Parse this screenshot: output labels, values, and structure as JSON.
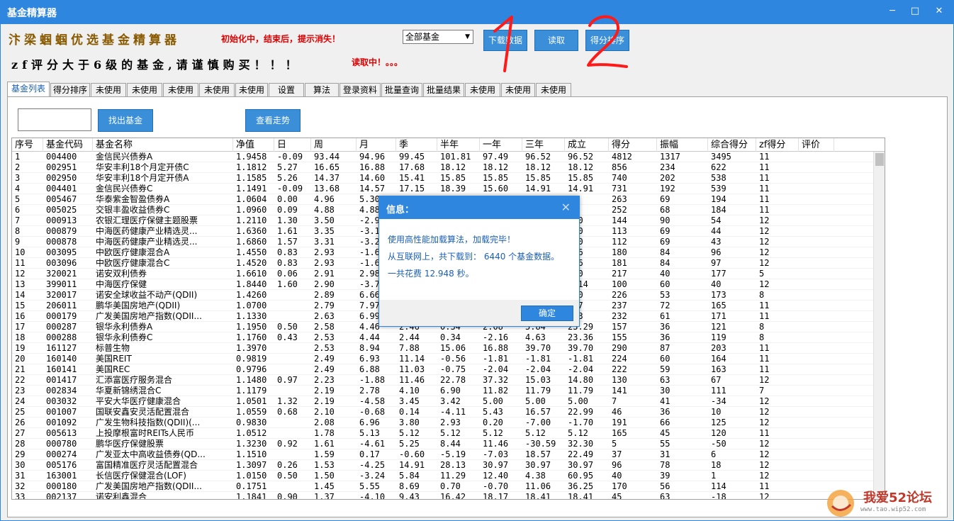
{
  "window": {
    "title": "基金精算器",
    "minimize": "─",
    "maximize": "□",
    "close": "✕"
  },
  "header": {
    "brand": "汴梁蝈蝈优选基金精算器",
    "init_message": "初始化中，结束后，提示消失！",
    "warning": "zf评分大于6级的基金,请谨慎购买！！！",
    "reading_status": "读取中！。。。",
    "filter_select": "全部基金",
    "download_button": "下载数据",
    "read_button": "读取",
    "sort_button": "得分排序",
    "annotation_1": "1",
    "annotation_2": "2"
  },
  "tabs": [
    "基金列表",
    "得分排序",
    "未使用",
    "未使用",
    "未使用",
    "未使用",
    "未使用",
    "设置",
    "算法",
    "登录资料",
    "批量查询",
    "批量结果",
    "未使用",
    "未使用",
    "未使用"
  ],
  "toolbar": {
    "find_button": "找出基金",
    "trend_button": "查看走势"
  },
  "grid": {
    "columns": [
      "序号",
      "基金代码",
      "基金名称",
      "净值",
      "日",
      "周",
      "月",
      "季",
      "半年",
      "一年",
      "三年",
      "成立",
      "得分",
      "振幅",
      "综合得分",
      "zf得分",
      "评价"
    ],
    "rows": [
      [
        "1",
        "004400",
        "金信民兴债券A",
        "1.9458",
        "-0.09",
        "93.44",
        "94.96",
        "99.45",
        "101.81",
        "97.49",
        "96.52",
        "96.52",
        "4812",
        "1317",
        "3495",
        "11",
        ""
      ],
      [
        "2",
        "002951",
        "华安丰利18个月定开债C",
        "1.1812",
        "5.27",
        "16.65",
        "16.88",
        "17.68",
        "18.12",
        "18.12",
        "18.12",
        "18.12",
        "856",
        "234",
        "622",
        "11",
        ""
      ],
      [
        "3",
        "002950",
        "华安丰利18个月定开债A",
        "1.1585",
        "5.26",
        "14.37",
        "14.60",
        "15.41",
        "15.85",
        "15.85",
        "15.85",
        "15.85",
        "740",
        "202",
        "538",
        "11",
        ""
      ],
      [
        "4",
        "004401",
        "金信民兴债券C",
        "1.1491",
        "-0.09",
        "13.68",
        "14.57",
        "17.15",
        "18.39",
        "15.60",
        "14.91",
        "14.91",
        "731",
        "192",
        "539",
        "11",
        ""
      ],
      [
        "5",
        "005467",
        "华泰紫金智盈债券A",
        "1.0604",
        "0.00",
        "4.96",
        "5.30",
        "",
        "",
        "",
        "",
        "04",
        "263",
        "69",
        "194",
        "11",
        ""
      ],
      [
        "6",
        "005025",
        "交银丰盈收益债券C",
        "1.0960",
        "0.09",
        "4.88",
        "4.88",
        "",
        "",
        "",
        "",
        "93",
        "252",
        "68",
        "184",
        "11",
        ""
      ],
      [
        "7",
        "000913",
        "农银汇理医疗保健主题股票",
        "1.2110",
        "1.30",
        "3.50",
        "-2.95",
        "",
        "",
        "",
        "",
        ".10",
        "144",
        "90",
        "54",
        "12",
        ""
      ],
      [
        "8",
        "000879",
        "中海医药健康产业精选灵...",
        "1.6360",
        "1.61",
        "3.35",
        "-3.14",
        "",
        "",
        "",
        "",
        ".60",
        "113",
        "69",
        "44",
        "12",
        ""
      ],
      [
        "9",
        "000878",
        "中海医药健康产业精选灵...",
        "1.6860",
        "1.57",
        "3.31",
        "-3.21",
        "",
        "",
        "",
        "",
        ".60",
        "112",
        "69",
        "43",
        "12",
        ""
      ],
      [
        "10",
        "003095",
        "中欧医疗健康混合A",
        "1.4550",
        "0.83",
        "2.93",
        "-1.69",
        "",
        "",
        "",
        "",
        ".36",
        "180",
        "84",
        "96",
        "12",
        ""
      ],
      [
        "11",
        "003096",
        "中欧医疗健康混合C",
        "1.4520",
        "0.83",
        "2.93",
        "-1.69",
        "",
        "",
        "",
        "",
        ".06",
        "181",
        "84",
        "97",
        "12",
        ""
      ],
      [
        "12",
        "320021",
        "诺安双利债券",
        "1.6610",
        "0.06",
        "2.91",
        "2.98",
        "",
        "",
        "",
        "",
        ".10",
        "217",
        "40",
        "177",
        "5",
        ""
      ],
      [
        "13",
        "399011",
        "中海医疗保健",
        "1.8440",
        "1.60",
        "2.90",
        "-3.76",
        "",
        "",
        "",
        "",
        "9.14",
        "100",
        "60",
        "40",
        "12",
        ""
      ],
      [
        "14",
        "320017",
        "诺安全球收益不动产(QDII)",
        "1.4260",
        "",
        "2.89",
        "6.66",
        "",
        "",
        "",
        "",
        ".60",
        "226",
        "53",
        "173",
        "8",
        ""
      ],
      [
        "15",
        "206011",
        "鹏华美国房地产(QDII)",
        "1.0700",
        "",
        "2.79",
        "7.97",
        "",
        "",
        "",
        "",
        ".57",
        "237",
        "72",
        "165",
        "11",
        ""
      ],
      [
        "16",
        "000179",
        "广发美国房地产指数(QDII...",
        "1.1330",
        "",
        "2.63",
        "6.99",
        "",
        "",
        "",
        "",
        ".63",
        "232",
        "61",
        "171",
        "11",
        ""
      ],
      [
        "17",
        "000287",
        "银华永利债券A",
        "1.1950",
        "0.50",
        "2.58",
        "4.46",
        "2.46",
        "0.34",
        "2.08",
        "5.84",
        "23.29",
        "157",
        "36",
        "121",
        "8",
        ""
      ],
      [
        "18",
        "000288",
        "银华永利债券C",
        "1.1760",
        "0.43",
        "2.53",
        "4.44",
        "2.44",
        "0.34",
        "-2.16",
        "4.63",
        "23.36",
        "155",
        "36",
        "119",
        "8",
        ""
      ],
      [
        "19",
        "161127",
        "标普生物",
        "1.3970",
        "",
        "2.53",
        "8.94",
        "7.88",
        "15.06",
        "16.88",
        "39.70",
        "39.70",
        "290",
        "87",
        "203",
        "11",
        ""
      ],
      [
        "20",
        "160140",
        "美国REIT",
        "0.9819",
        "",
        "2.49",
        "6.93",
        "11.14",
        "-0.56",
        "-1.81",
        "-1.81",
        "-1.81",
        "224",
        "60",
        "164",
        "11",
        ""
      ],
      [
        "21",
        "160141",
        "美国REC",
        "0.9796",
        "",
        "2.49",
        "6.88",
        "11.03",
        "-0.75",
        "-2.04",
        "-2.04",
        "-2.04",
        "222",
        "59",
        "163",
        "11",
        ""
      ],
      [
        "22",
        "001417",
        "汇添富医疗服务混合",
        "1.1480",
        "0.97",
        "2.23",
        "-1.88",
        "11.46",
        "22.78",
        "37.32",
        "15.03",
        "14.80",
        "130",
        "63",
        "67",
        "12",
        ""
      ],
      [
        "23",
        "002834",
        "华夏新锦绣混合C",
        "1.1179",
        "",
        "2.19",
        "2.78",
        "4.10",
        "6.90",
        "11.82",
        "11.79",
        "11.79",
        "141",
        "30",
        "111",
        "7",
        ""
      ],
      [
        "24",
        "003032",
        "平安大华医疗健康混合",
        "1.0501",
        "1.32",
        "2.19",
        "-4.58",
        "3.45",
        "3.42",
        "5.00",
        "5.00",
        "5.00",
        "7",
        "41",
        "-34",
        "12",
        ""
      ],
      [
        "25",
        "001007",
        "国联安鑫安灵活配置混合",
        "1.0559",
        "0.68",
        "2.10",
        "-0.68",
        "0.14",
        "-4.11",
        "5.43",
        "16.57",
        "22.99",
        "46",
        "36",
        "10",
        "12",
        ""
      ],
      [
        "26",
        "001092",
        "广发生物科技指数(QDII)(...",
        "0.9830",
        "",
        "2.08",
        "6.96",
        "3.80",
        "2.93",
        "0.20",
        "-7.00",
        "-1.70",
        "191",
        "66",
        "125",
        "12",
        ""
      ],
      [
        "27",
        "005613",
        "上投摩根富时REITs人民币",
        "1.0512",
        "",
        "1.78",
        "5.13",
        "5.12",
        "5.12",
        "5.12",
        "5.12",
        "5.12",
        "165",
        "45",
        "120",
        "11",
        ""
      ],
      [
        "28",
        "000780",
        "鹏华医疗保健股票",
        "1.3230",
        "0.92",
        "1.61",
        "-4.61",
        "5.25",
        "8.44",
        "11.46",
        "-30.59",
        "32.30",
        "5",
        "55",
        "-50",
        "12",
        ""
      ],
      [
        "29",
        "000274",
        "广发亚太中高收益债券(QD...",
        "1.1510",
        "",
        "1.59",
        "0.17",
        "-0.60",
        "-5.19",
        "-7.03",
        "18.57",
        "22.49",
        "37",
        "31",
        "6",
        "12",
        ""
      ],
      [
        "30",
        "005176",
        "富国精准医疗灵活配置混合",
        "1.3097",
        "0.26",
        "1.53",
        "-4.25",
        "14.91",
        "28.13",
        "30.97",
        "30.97",
        "30.97",
        "96",
        "78",
        "18",
        "12",
        ""
      ],
      [
        "31",
        "163001",
        "长信医疗保健混合(LOF)",
        "1.0150",
        "0.50",
        "1.50",
        "-3.24",
        "5.84",
        "11.29",
        "12.40",
        "4.38",
        "60.95",
        "40",
        "39",
        "1",
        "12",
        ""
      ],
      [
        "32",
        "000180",
        "广发美国房地产指数(QDII...",
        "0.1751",
        "",
        "1.45",
        "5.55",
        "8.69",
        "0.70",
        "-0.70",
        "11.06",
        "36.25",
        "170",
        "56",
        "114",
        "11",
        ""
      ],
      [
        "33",
        "002137",
        "诺安利鑫混合",
        "1.1841",
        "0.90",
        "1.37",
        "-4.10",
        "9.43",
        "16.42",
        "18.17",
        "18.41",
        "18.41",
        "45",
        "63",
        "-18",
        "12",
        ""
      ]
    ]
  },
  "dialog": {
    "title": "信息：",
    "close": "✕",
    "line1": "使用高性能加载算法，加载完毕！",
    "line2": "从互联网上，共下载到： 6440 个基金数据。",
    "line3": "一共花费   12.948   秒。",
    "ok_button": "确定"
  },
  "watermark": {
    "text": "我爱52论坛",
    "url": "www.tao.wip52.com"
  },
  "colors": {
    "titlebar": "#2e86de",
    "button": "#3a8fd8",
    "warning_red": "#e00000",
    "brand_brown": "#8a5a00",
    "dialog_text": "#1a5fb4"
  }
}
